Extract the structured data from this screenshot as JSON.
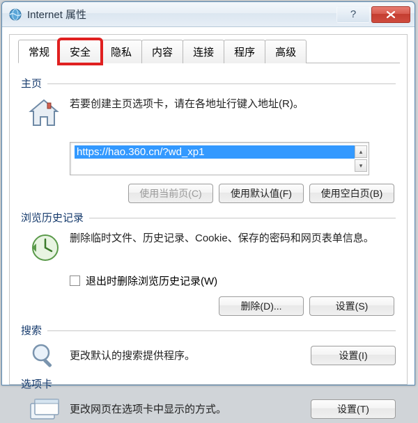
{
  "window": {
    "title": "Internet 属性"
  },
  "tabs": {
    "general": "常规",
    "security": "安全",
    "privacy": "隐私",
    "content": "内容",
    "connections": "连接",
    "programs": "程序",
    "advanced": "高级"
  },
  "homepage": {
    "group_label": "主页",
    "desc": "若要创建主页选项卡，请在各地址行键入地址(R)。",
    "url": "https://hao.360.cn/?wd_xp1",
    "buttons": {
      "use_current": "使用当前页(C)",
      "use_default": "使用默认值(F)",
      "use_blank": "使用空白页(B)"
    }
  },
  "history": {
    "group_label": "浏览历史记录",
    "desc": "删除临时文件、历史记录、Cookie、保存的密码和网页表单信息。",
    "checkbox_label": "退出时删除浏览历史记录(W)",
    "buttons": {
      "delete": "删除(D)...",
      "settings": "设置(S)"
    }
  },
  "search": {
    "group_label": "搜索",
    "desc": "更改默认的搜索提供程序。",
    "buttons": {
      "settings": "设置(I)"
    }
  },
  "tabs_section": {
    "group_label": "选项卡",
    "desc": "更改网页在选项卡中显示的方式。",
    "buttons": {
      "settings": "设置(T)"
    }
  }
}
